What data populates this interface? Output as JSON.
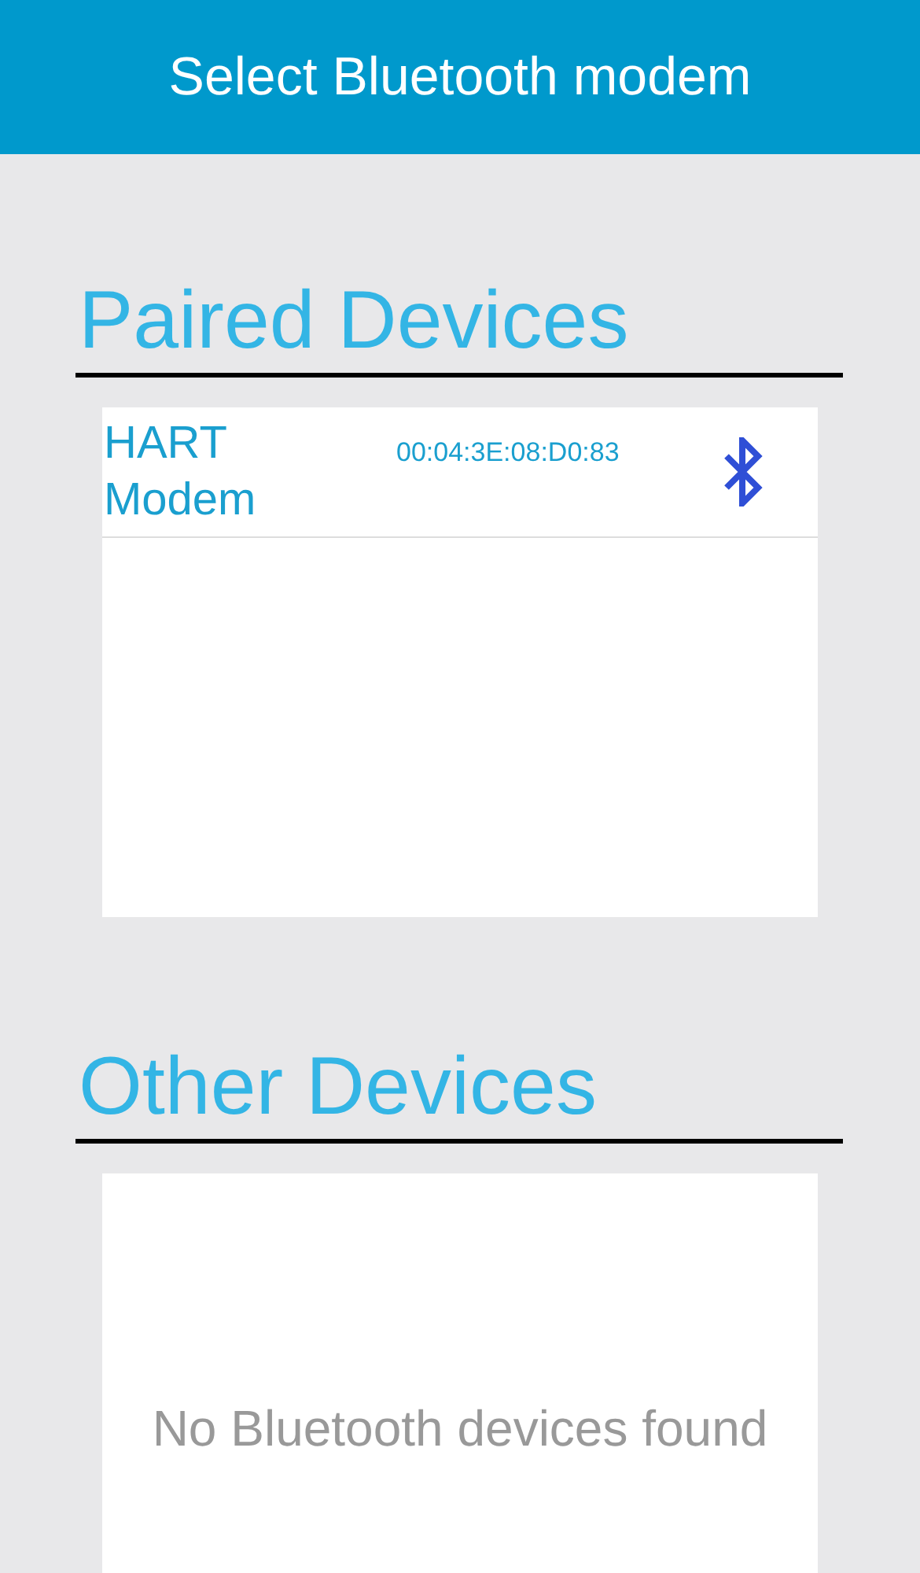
{
  "title": "Select Bluetooth modem",
  "sections": [
    {
      "kind": "paired",
      "title": "Paired Devices",
      "devices": [
        {
          "name": "HART Modem",
          "address": "00:04:3E:08:D0:83"
        }
      ]
    },
    {
      "kind": "other",
      "title": "Other Devices",
      "empty_message": "No Bluetooth devices found"
    }
  ]
}
